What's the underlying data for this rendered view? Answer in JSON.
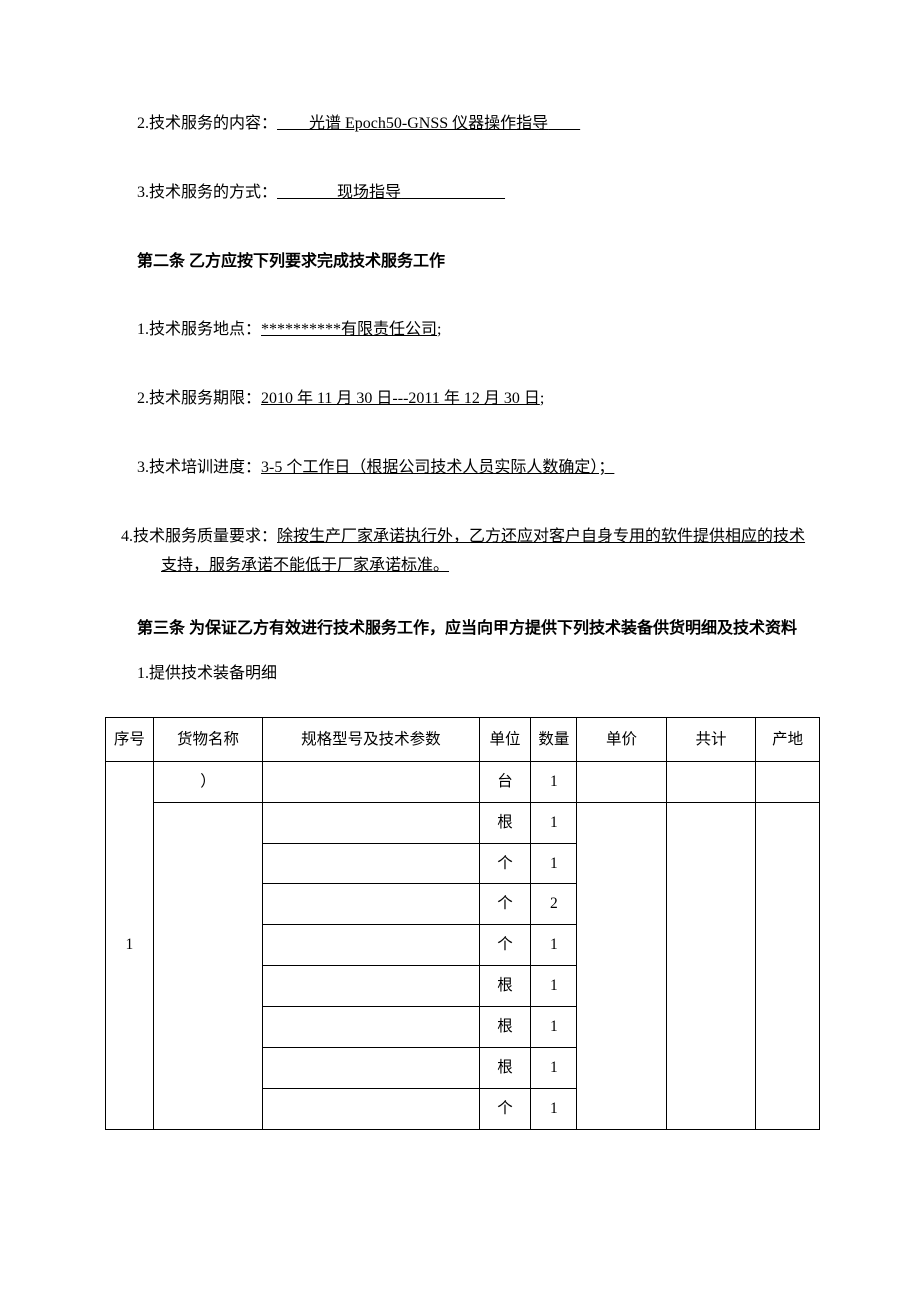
{
  "p2": {
    "label": "2.技术服务的内容：",
    "blank_before": "        ",
    "underline": "光谱 Epoch50-GNSS 仪器操作指导",
    "blank_after": "        "
  },
  "p3": {
    "label": "3.技术服务的方式：",
    "blank_before": "               ",
    "underline": "现场指导",
    "blank_after": "                          "
  },
  "s2_heading": "第二条 乙方应按下列要求完成技术服务工作",
  "s2_1": {
    "label": "1.技术服务地点：",
    "underline": "**********有限责任公司",
    "tail": ";"
  },
  "s2_2": {
    "label": "2.技术服务期限：",
    "underline": "2010 年 11 月 30 日---2011 年 12 月 30 日",
    "tail": ";"
  },
  "s2_3": {
    "label": "3.技术培训进度：",
    "underline": "3-5 个工作日（根据公司技术人员实际人数确定）；"
  },
  "s2_4": {
    "label": "4.技术服务质量要求：",
    "underline": "除按生产厂家承诺执行外，乙方还应对客户自身专用的软件提供相应的技术支持，服务承诺不能低于厂家承诺标准。"
  },
  "s3_heading_bold": "第三条 为保证乙方有效进行技术服务工作，",
  "s3_heading_rest_bold": "应当向甲方提供下列技术装备供货明细及技术资料",
  "s3_1": "1.提供技术装备明细",
  "table": {
    "headers": [
      "序号",
      "货物名称",
      "规格型号及技术参数",
      "单位",
      "数量",
      "单价",
      "共计",
      "产地"
    ],
    "seq1": "1",
    "row1_name": "）",
    "rows": [
      {
        "unit": "台",
        "qty": "1"
      },
      {
        "unit": "根",
        "qty": "1"
      },
      {
        "unit": "个",
        "qty": "1"
      },
      {
        "unit": "个",
        "qty": "2"
      },
      {
        "unit": "个",
        "qty": "1"
      },
      {
        "unit": "根",
        "qty": "1"
      },
      {
        "unit": "根",
        "qty": "1"
      },
      {
        "unit": "根",
        "qty": "1"
      },
      {
        "unit": "个",
        "qty": "1"
      }
    ]
  }
}
